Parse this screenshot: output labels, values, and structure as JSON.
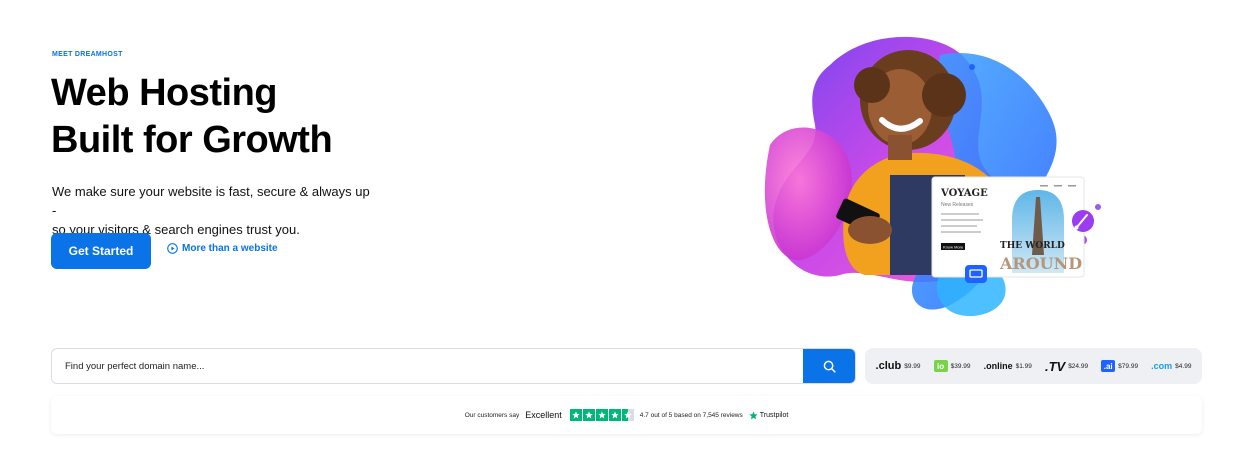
{
  "hero": {
    "eyebrow": "MEET DREAMHOST",
    "headline_line1": "Web Hosting",
    "headline_line2": "Built for Growth",
    "subhead_line1": "We make sure your website is fast, secure & always up -",
    "subhead_line2": "so your visitors & search engines trust you. Guaranteed.",
    "cta_label": "Get Started",
    "more_link_label": "More than a website"
  },
  "mockup": {
    "title": "VOYAGE",
    "subtitle": "New Releases",
    "button": "Know More",
    "overlay_line1": "THE WORLD",
    "overlay_line2": "AROUND"
  },
  "search": {
    "placeholder": "Find your perfect domain name..."
  },
  "tlds": [
    {
      "name": ".club",
      "price": "$9.99"
    },
    {
      "name": "io",
      "price": "$39.99"
    },
    {
      "name": ".online",
      "price": "$1.99"
    },
    {
      "name": ".TV",
      "price": "$24.99"
    },
    {
      "name": ".ai",
      "price": "$79.99"
    },
    {
      "name": ".com",
      "price": "$4.99"
    }
  ],
  "trust": {
    "prefix": "Our customers say",
    "rating_word": "Excellent",
    "summary": "4.7 out of 5 based on 7,545 reviews",
    "brand": "Trustpilot"
  },
  "colors": {
    "accent": "#0a73e8",
    "trustpilot_green": "#00b67a"
  }
}
